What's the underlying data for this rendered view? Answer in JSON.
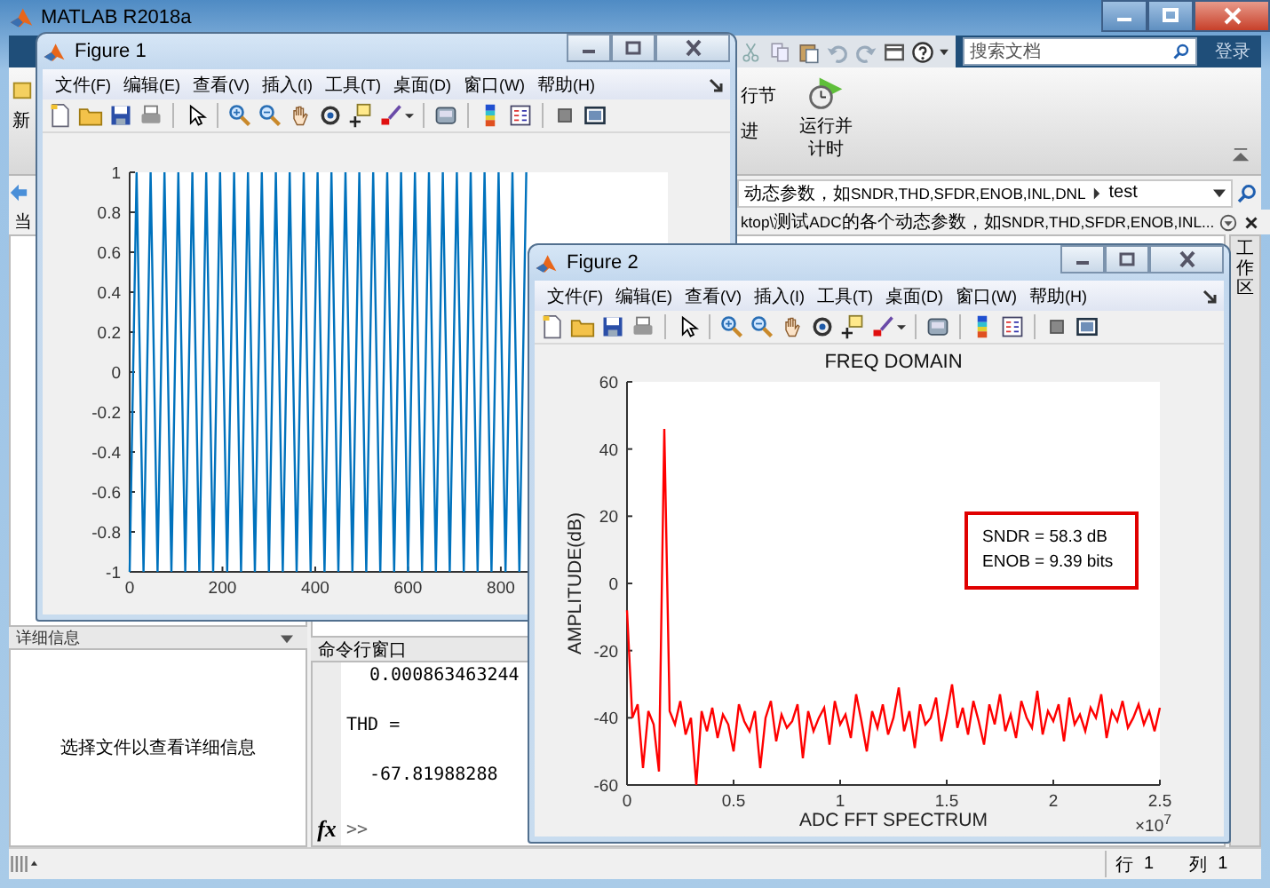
{
  "main_window": {
    "title": "MATLAB R2018a",
    "search": {
      "placeholder": "搜索文档"
    },
    "login_button": "登录",
    "ribbon": {
      "left_label": "新",
      "partial_labels": [
        "行节",
        "进"
      ],
      "run_and_time_button": "运行并计时"
    },
    "path_bar": {
      "path": "动态参数，如SNDR,THD,SFDR,ENOB,INL,DNL",
      "folder": "test"
    },
    "left_header": "当",
    "editor_tab": "ktop\\测试ADC的各个动态参数，如SNDR,THD,SFDR,ENOB,INL...",
    "side_tab": "工作区",
    "details_panel": {
      "title": "详细信息",
      "message": "选择文件以查看详细信息"
    },
    "command_window": {
      "title": "命令行窗口",
      "lines": [
        {
          "kind": "value",
          "text": "0.000863463244"
        },
        {
          "kind": "label",
          "text": "THD ="
        },
        {
          "kind": "value",
          "text": "-67.81988288"
        }
      ],
      "fx_label": "fx",
      "prompt": ">>"
    },
    "status_bar": {
      "row_label": "行",
      "row": "1",
      "col_label": "列",
      "col": "1"
    }
  },
  "figures": [
    {
      "title": "Figure 1",
      "menu": [
        "文件(F)",
        "编辑(E)",
        "查看(V)",
        "插入(I)",
        "工具(T)",
        "桌面(D)",
        "窗口(W)",
        "帮助(H)"
      ],
      "chart_data": {
        "type": "line",
        "xlim": [
          0,
          1160
        ],
        "ylim": [
          -1,
          1
        ],
        "xticks": [
          0,
          200,
          400,
          600,
          800
        ],
        "yticks": [
          -1,
          -0.8,
          -0.6,
          -0.4,
          -0.2,
          0,
          0.2,
          0.4,
          0.6,
          0.8,
          1
        ],
        "x": [
          0,
          15,
          30,
          45,
          60,
          75,
          90,
          105,
          120,
          135,
          150,
          165,
          180,
          195,
          210,
          225,
          240,
          255,
          270,
          285,
          300,
          315,
          330,
          345,
          360,
          375,
          390,
          405,
          420,
          435,
          450,
          465,
          480,
          495,
          510,
          525,
          540,
          555,
          570,
          585,
          600,
          615,
          630,
          645,
          660,
          675,
          690,
          705,
          720,
          735,
          750,
          765,
          780,
          795,
          810,
          825,
          840,
          855
        ],
        "series": [
          {
            "color": "#0072bd",
            "values": [
              -1,
              1,
              -1,
              1,
              -1,
              1,
              -1,
              1,
              -1,
              1,
              -1,
              1,
              -1,
              1,
              -1,
              1,
              -1,
              1,
              -1,
              1,
              -1,
              1,
              -1,
              1,
              -1,
              1,
              -1,
              1,
              -1,
              1,
              -1,
              1,
              -1,
              1,
              -1,
              1,
              -1,
              1,
              -1,
              1,
              -1,
              1,
              -1,
              1,
              -1,
              1,
              -1,
              1,
              -1,
              1,
              -1,
              1,
              -1,
              1,
              -1,
              1,
              -1,
              1
            ]
          }
        ]
      }
    },
    {
      "title": "Figure 2",
      "x_axis_exponent": "×10$^{7}$",
      "menu": [
        "文件(F)",
        "编辑(E)",
        "查看(V)",
        "插入(I)",
        "工具(T)",
        "桌面(D)",
        "窗口(W)",
        "帮助(H)"
      ],
      "chart_data": {
        "type": "line",
        "title": "FREQ DOMAIN",
        "xlabel": "ADC FFT SPECTRUM",
        "ylabel": "AMPLITUDE(dB)",
        "xlim": [
          0,
          2.5
        ],
        "ylim": [
          -60,
          60
        ],
        "xticks": [
          0,
          0.5,
          1,
          1.5,
          2,
          2.5
        ],
        "yticks": [
          -60,
          -40,
          -20,
          0,
          20,
          40,
          60
        ],
        "x": [
          0,
          0.025,
          0.05,
          0.075,
          0.1,
          0.125,
          0.15,
          0.175,
          0.2,
          0.225,
          0.25,
          0.275,
          0.3,
          0.325,
          0.35,
          0.375,
          0.4,
          0.425,
          0.45,
          0.475,
          0.5,
          0.525,
          0.55,
          0.575,
          0.6,
          0.625,
          0.65,
          0.675,
          0.7,
          0.725,
          0.75,
          0.775,
          0.8,
          0.825,
          0.85,
          0.875,
          0.9,
          0.925,
          0.95,
          0.975,
          1,
          1.025,
          1.05,
          1.075,
          1.1,
          1.125,
          1.15,
          1.175,
          1.2,
          1.225,
          1.25,
          1.275,
          1.3,
          1.325,
          1.35,
          1.375,
          1.4,
          1.425,
          1.45,
          1.475,
          1.5,
          1.525,
          1.55,
          1.575,
          1.6,
          1.625,
          1.65,
          1.675,
          1.7,
          1.725,
          1.75,
          1.775,
          1.8,
          1.825,
          1.85,
          1.875,
          1.9,
          1.925,
          1.95,
          1.975,
          2,
          2.025,
          2.05,
          2.075,
          2.1,
          2.125,
          2.15,
          2.175,
          2.2,
          2.225,
          2.25,
          2.275,
          2.3,
          2.325,
          2.35,
          2.375,
          2.4,
          2.425,
          2.45,
          2.475,
          2.5
        ],
        "series": [
          {
            "color": "#ff0000",
            "values": [
              -8,
              -40,
              -36,
              -55,
              -38,
              -42,
              -56,
              46,
              -38,
              -42,
              -35,
              -45,
              -40,
              -60,
              -38,
              -44,
              -37,
              -46,
              -39,
              -42,
              -50,
              -36,
              -41,
              -44,
              -38,
              -55,
              -40,
              -35,
              -47,
              -39,
              -43,
              -41,
              -36,
              -52,
              -38,
              -44,
              -40,
              -37,
              -48,
              -35,
              -42,
              -39,
              -46,
              -33,
              -41,
              -50,
              -38,
              -43,
              -36,
              -45,
              -40,
              -31,
              -44,
              -38,
              -49,
              -36,
              -42,
              -40,
              -34,
              -47,
              -39,
              -30,
              -43,
              -37,
              -45,
              -35,
              -41,
              -48,
              -36,
              -42,
              -33,
              -44,
              -39,
              -46,
              -35,
              -40,
              -43,
              -32,
              -45,
              -38,
              -41,
              -36,
              -47,
              -34,
              -42,
              -39,
              -44,
              -37,
              -40,
              -33,
              -46,
              -38,
              -41,
              -35,
              -43,
              -40,
              -36,
              -42,
              -38,
              -44,
              -37
            ]
          }
        ],
        "annotations": [
          "SNDR = 58.3 dB\nENOB = 9.39 bits"
        ]
      }
    }
  ]
}
